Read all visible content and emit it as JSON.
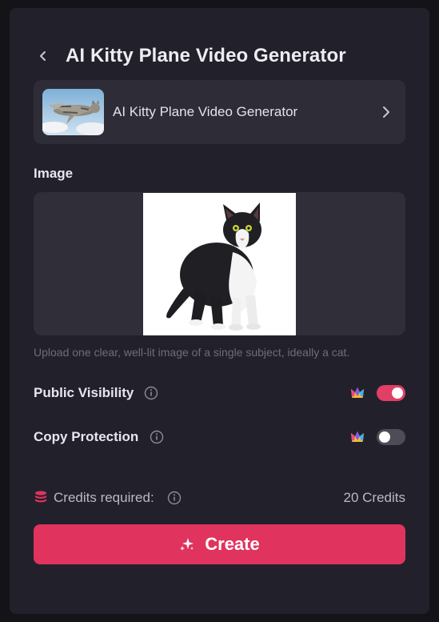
{
  "header": {
    "title": "AI Kitty Plane Video Generator",
    "back_icon": "chevron-left-icon"
  },
  "tool_card": {
    "name": "AI Kitty Plane Video Generator",
    "thumbnail": "kitty-plane-thumbnail",
    "chevron_icon": "chevron-right-icon"
  },
  "image_section": {
    "label": "Image",
    "uploaded_image": "black-white-cat-photo",
    "hint": "Upload one clear, well-lit image of a single subject, ideally a cat."
  },
  "options": [
    {
      "label": "Public Visibility",
      "info_icon": "info-icon",
      "premium_icon": "crown-icon",
      "enabled": true
    },
    {
      "label": "Copy Protection",
      "info_icon": "info-icon",
      "premium_icon": "crown-icon",
      "enabled": false
    }
  ],
  "credits": {
    "label": "Credits required:",
    "value": "20 Credits",
    "icon": "coins-stack-icon"
  },
  "create_button": {
    "label": "Create",
    "icon": "sparkle-icon"
  },
  "colors": {
    "background": "#141318",
    "panel": "#22212b",
    "card": "#2d2c37",
    "accent": "#e0335e",
    "toggle_on": "#e23f66",
    "toggle_off": "#4d4c57",
    "muted_text": "#6d6c7b"
  }
}
